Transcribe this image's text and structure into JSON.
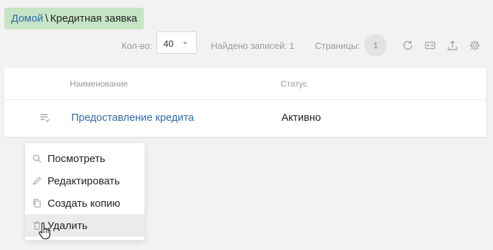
{
  "breadcrumb": {
    "home": "Домой",
    "separator": "\\",
    "current": "Кредитная заявка"
  },
  "toolbar": {
    "size_label": "Кол-во:",
    "size_value": "40",
    "found_label": "Найдено записей: 1",
    "pages_label": "Страницы:",
    "current_page": "1",
    "icons": [
      "refresh-icon",
      "columns-icon",
      "export-icon",
      "settings-icon"
    ]
  },
  "table": {
    "columns": [
      "Наименование",
      "Статус"
    ],
    "rows": [
      {
        "name": "Предоставление кредита",
        "status": "Активно"
      }
    ]
  },
  "context_menu": {
    "items": [
      {
        "label": "Посмотреть",
        "icon": "search-icon"
      },
      {
        "label": "Редактировать",
        "icon": "pencil-icon"
      },
      {
        "label": "Создать копию",
        "icon": "copy-icon"
      },
      {
        "label": "Удалить",
        "icon": "trash-icon"
      }
    ],
    "hovered_item": "Удалить"
  },
  "colors": {
    "link": "#2f6aa8",
    "breadcrumb_bg": "#c6e5c6",
    "page_bg": "#f2f2f2"
  }
}
